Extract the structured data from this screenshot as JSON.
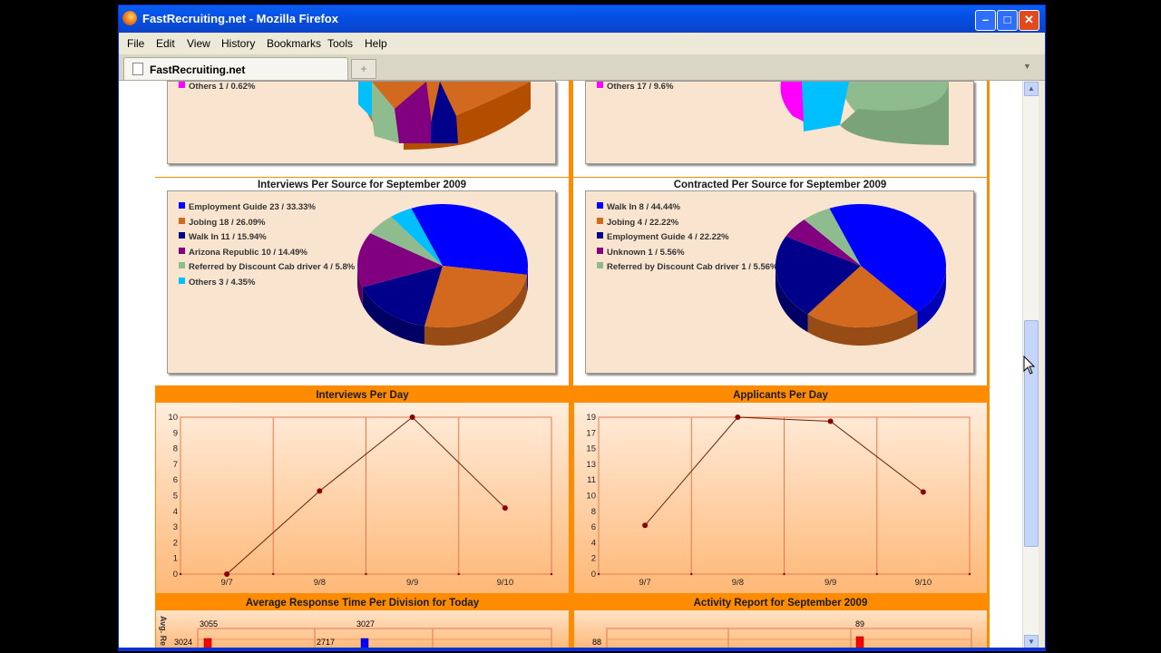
{
  "window": {
    "title": "FastRecruiting.net - Mozilla Firefox",
    "min_glyph": "–",
    "max_glyph": "□",
    "close_glyph": "✕"
  },
  "menu": [
    "File",
    "Edit",
    "View",
    "History",
    "Bookmarks",
    "Tools",
    "Help"
  ],
  "tab": {
    "label": "FastRecruiting.net",
    "new_tab_glyph": "+"
  },
  "colors": {
    "page_bg": "#ff8c00",
    "chart_bg": "#f9e5cf",
    "line": "#6b1e0a",
    "point": "#8b0000"
  },
  "top_partial": {
    "left_legend": {
      "label": "Others  1 / 0.62%",
      "color": "#ff00ff"
    },
    "right_legend": {
      "label": "Others  17 / 9.6%",
      "color": "#ff00ff"
    }
  },
  "chart_data": [
    {
      "type": "pie",
      "title": "Interviews Per Source for September 2009",
      "slices": [
        {
          "label": "Employment Guide  23 / 33.33%",
          "name": "Employment Guide",
          "value": 23,
          "percent": 33.33,
          "color": "#0000ff"
        },
        {
          "label": "Jobing  18 / 26.09%",
          "name": "Jobing",
          "value": 18,
          "percent": 26.09,
          "color": "#d2691e"
        },
        {
          "label": "Walk In  11 / 15.94%",
          "name": "Walk In",
          "value": 11,
          "percent": 15.94,
          "color": "#00008b"
        },
        {
          "label": "Arizona Republic  10 / 14.49%",
          "name": "Arizona Republic",
          "value": 10,
          "percent": 14.49,
          "color": "#800080"
        },
        {
          "label": "Referred by Discount Cab driver  4 / 5.8%",
          "name": "Referred by Discount Cab driver",
          "value": 4,
          "percent": 5.8,
          "color": "#8fbc8f"
        },
        {
          "label": "Others  3 / 4.35%",
          "name": "Others",
          "value": 3,
          "percent": 4.35,
          "color": "#00bfff"
        }
      ]
    },
    {
      "type": "pie",
      "title": "Contracted Per Source for September 2009",
      "slices": [
        {
          "label": "Walk In  8 / 44.44%",
          "name": "Walk In",
          "value": 8,
          "percent": 44.44,
          "color": "#0000ff"
        },
        {
          "label": "Jobing  4 / 22.22%",
          "name": "Jobing",
          "value": 4,
          "percent": 22.22,
          "color": "#d2691e"
        },
        {
          "label": "Employment Guide  4 / 22.22%",
          "name": "Employment Guide",
          "value": 4,
          "percent": 22.22,
          "color": "#00008b"
        },
        {
          "label": "Unknown  1 / 5.56%",
          "name": "Unknown",
          "value": 1,
          "percent": 5.56,
          "color": "#800080"
        },
        {
          "label": "Referred by Discount Cab driver  1 / 5.56%",
          "name": "Referred by Discount Cab driver",
          "value": 1,
          "percent": 5.56,
          "color": "#8fbc8f"
        }
      ]
    },
    {
      "type": "line",
      "title": "Interviews Per Day",
      "x": [
        "9/7",
        "9/8",
        "9/9",
        "9/10"
      ],
      "y": [
        0,
        5.4,
        10.2,
        4.3
      ],
      "yticks": [
        0,
        1,
        2,
        3,
        4,
        5,
        6,
        7,
        8,
        9,
        10
      ],
      "ylim": [
        0,
        10.2
      ]
    },
    {
      "type": "line",
      "title": "Applicants Per Day",
      "x": [
        "9/7",
        "9/8",
        "9/9",
        "9/10"
      ],
      "y": [
        6,
        19.3,
        18.8,
        10.1
      ],
      "yticks": [
        0,
        2,
        4,
        6,
        8,
        10,
        11,
        13,
        15,
        17,
        19
      ],
      "ylim": [
        0,
        19.3
      ]
    },
    {
      "type": "bar",
      "title": "Average Response Time Per Division for Today",
      "ylabel": "Avg. Re",
      "values": [
        3055,
        3027
      ],
      "ytick_labels": [
        "3024",
        "2717"
      ]
    },
    {
      "type": "bar",
      "title": "Activity Report for September 2009",
      "values": [
        89
      ],
      "ytick_labels": [
        "88"
      ]
    }
  ]
}
